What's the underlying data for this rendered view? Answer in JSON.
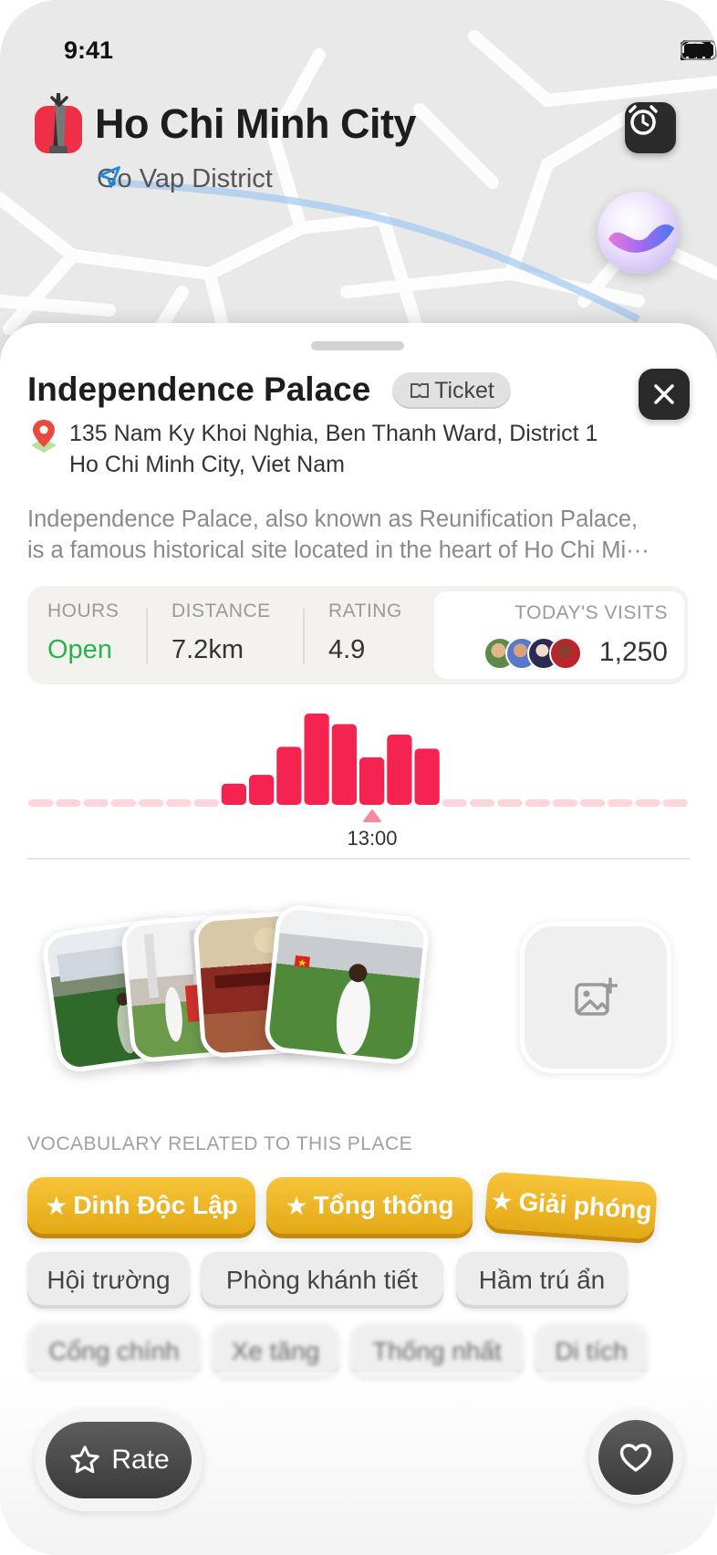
{
  "status_bar": {
    "time": "9:41"
  },
  "location": {
    "city": "Ho Chi Minh City",
    "district": "Go Vap District"
  },
  "place": {
    "name": "Independence Palace",
    "ticket_label": "Ticket",
    "address_line1": "135 Nam Ky Khoi Nghia, Ben Thanh Ward, District 1",
    "address_line2": "Ho Chi Minh City, Viet Nam",
    "description_line1": "Independence Palace, also known as Reunification Palace,",
    "description_line2": "is a famous historical site located in the heart of Ho Chi Mi···"
  },
  "stats": {
    "hours_label": "HOURS",
    "hours_value": "Open",
    "distance_label": "DISTANCE",
    "distance_value": "7.2km",
    "rating_label": "RATING",
    "rating_value": "4.9",
    "visits_label": "TODAY'S VISITS",
    "visits_value": "1,250"
  },
  "chart_data": {
    "type": "bar",
    "title": "",
    "xlabel": "",
    "ylabel": "",
    "selected_time_label": "13:00",
    "values": [
      0,
      0,
      0,
      0,
      0,
      0,
      0,
      18,
      28,
      60,
      98,
      86,
      48,
      74,
      58,
      0,
      0,
      0,
      0,
      0,
      0,
      0,
      0,
      0
    ],
    "ylim": [
      0,
      100
    ],
    "colors": {
      "bar": "#f5234f",
      "empty": "#fbd6dd"
    }
  },
  "photos": {
    "add_photo_icon": "image-plus-icon"
  },
  "vocabulary": {
    "heading": "VOCABULARY RELATED TO THIS PLACE",
    "starred": [
      "Dinh Độc Lập",
      "Tổng thống",
      "Giải phóng"
    ],
    "regular": [
      "Hội trường",
      "Phòng khánh tiết",
      "Hầm trú ẩn"
    ],
    "locked": [
      "Cổng chính",
      "Xe tăng",
      "Thống nhất",
      "Di tích"
    ]
  },
  "actions": {
    "rate_label": "Rate"
  },
  "colors": {
    "accent": "#f5234f",
    "open": "#2bb24c",
    "gold": "#f2b727"
  }
}
